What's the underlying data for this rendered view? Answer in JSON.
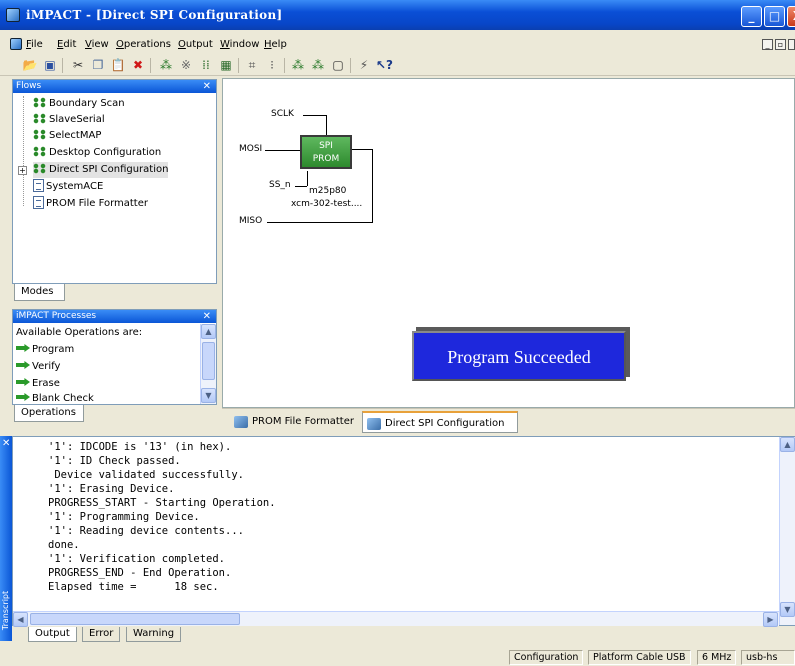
{
  "window": {
    "title": "iMPACT - [Direct SPI Configuration]"
  },
  "menu": [
    "File",
    "Edit",
    "View",
    "Operations",
    "Output",
    "Window",
    "Help"
  ],
  "toolbar_icons": [
    "open-icon",
    "save-icon",
    "cut-icon",
    "copy-icon",
    "paste-icon",
    "delete-icon",
    "chain-icon",
    "tools-icon",
    "grid-icon",
    "grid2-icon",
    "align-icon",
    "bar-icon",
    "program-icon",
    "verify-icon",
    "erase-icon",
    "cable-icon",
    "help-pointer-icon"
  ],
  "flows": {
    "title": "Flows",
    "items": [
      "Boundary Scan",
      "SlaveSerial",
      "SelectMAP",
      "Desktop Configuration",
      "Direct SPI Configuration",
      "SystemACE",
      "PROM File Formatter"
    ],
    "tab": "Modes"
  },
  "processes": {
    "title": "iMPACT Processes",
    "header": "Available Operations are:",
    "items": [
      "Program",
      "Verify",
      "Erase",
      "Blank Check"
    ],
    "tab": "Operations"
  },
  "diagram": {
    "sclk": "SCLK",
    "mosi": "MOSI",
    "ss": "SS_n",
    "miso": "MISO",
    "chip_line1": "SPI",
    "chip_line2": "PROM",
    "part": "m25p80",
    "file": "xcm-302-test...."
  },
  "message": "Program Succeeded",
  "doc_tabs": [
    "PROM File Formatter",
    "Direct SPI Configuration"
  ],
  "transcript": {
    "side_label": "Transcript",
    "lines": [
      "'1': IDCODE is '13' (in hex).",
      "'1': ID Check passed.",
      " Device validated successfully.",
      "'1': Erasing Device.",
      "PROGRESS_START - Starting Operation.",
      "'1': Programming Device.",
      "'1': Reading device contents...",
      "done.",
      "'1': Verification completed.",
      "PROGRESS_END - End Operation.",
      "Elapsed time =      18 sec."
    ],
    "tabs": [
      "Output",
      "Error",
      "Warning"
    ]
  },
  "status": [
    "Configuration",
    "Platform Cable USB",
    "6 MHz",
    "usb-hs"
  ]
}
